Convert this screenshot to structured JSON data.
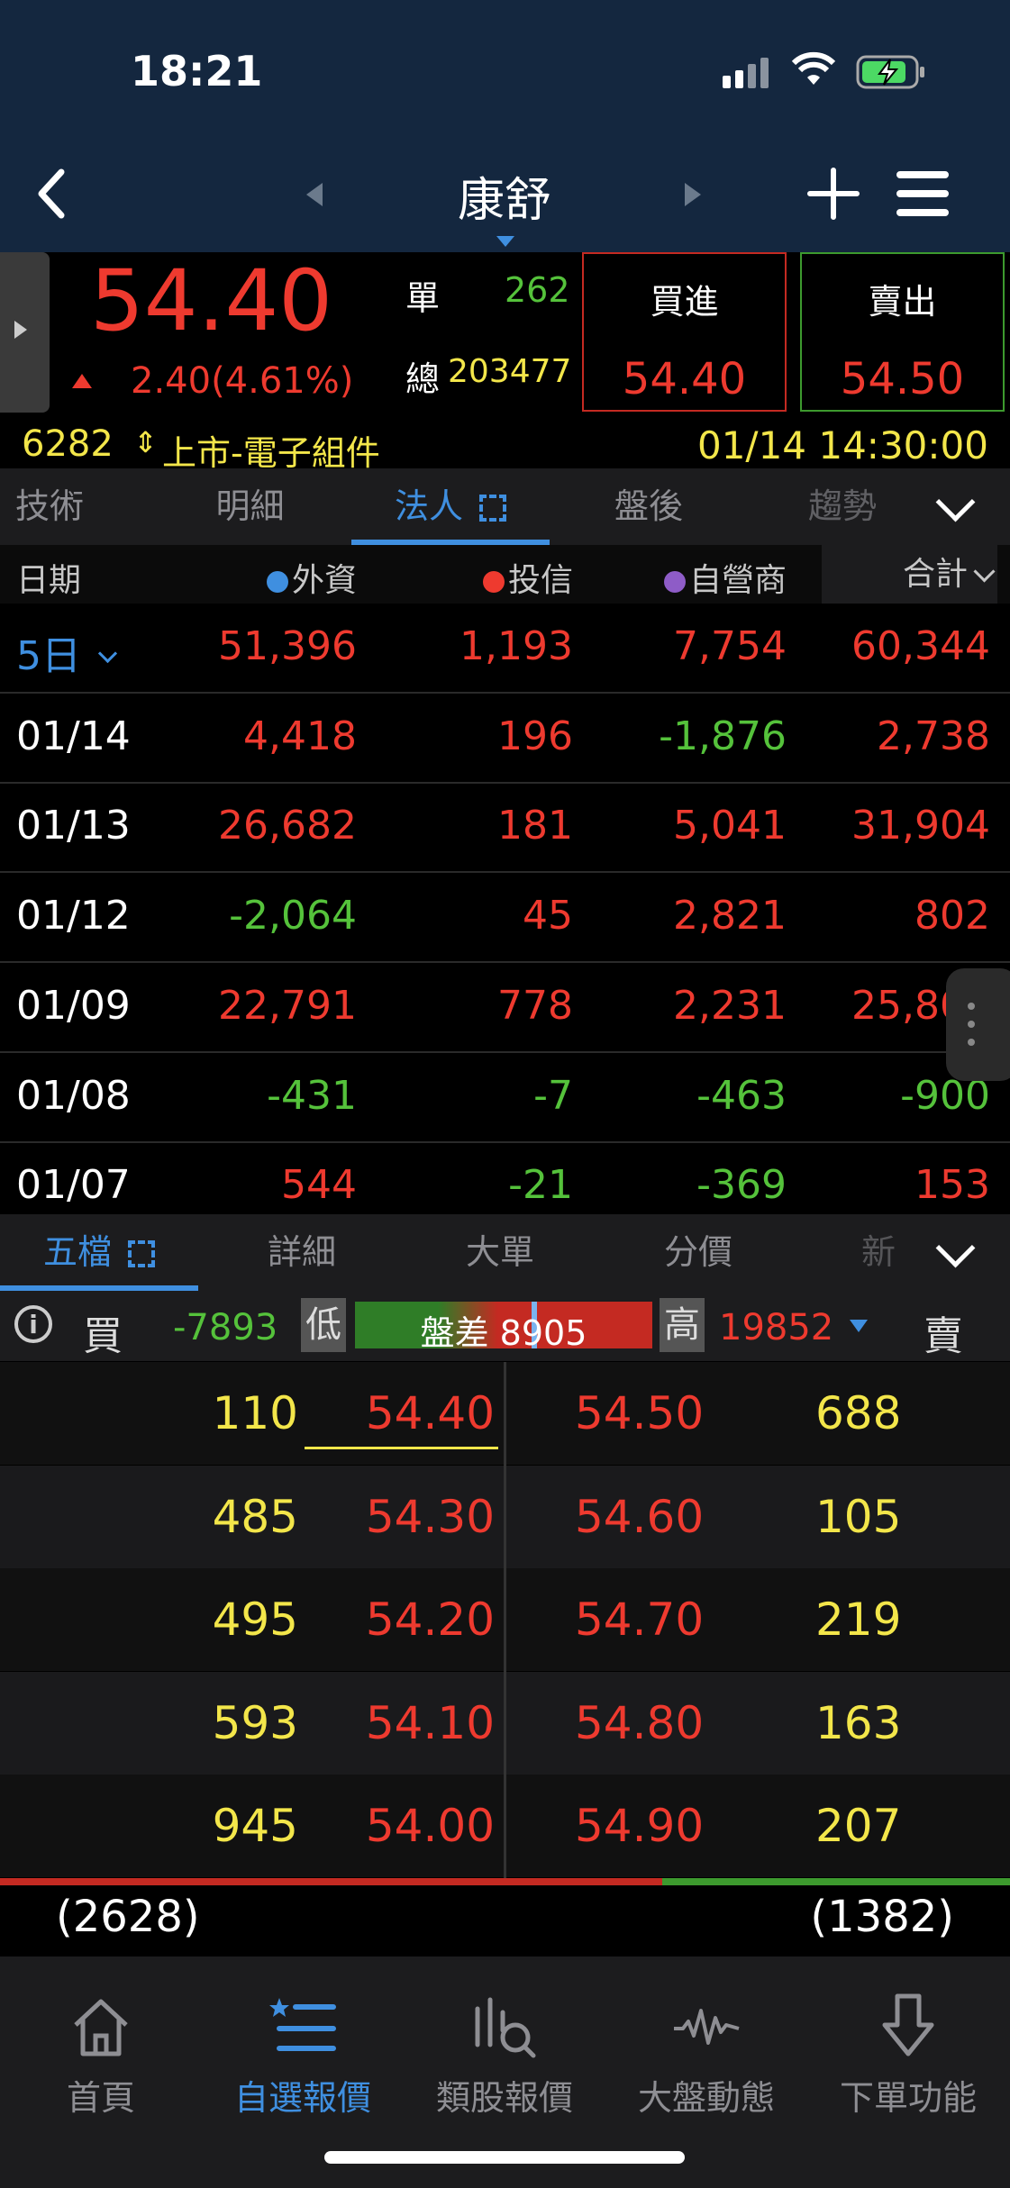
{
  "status_bar": {
    "time": "18:21"
  },
  "header": {
    "title": "康舒"
  },
  "quote": {
    "price": "54.40",
    "change": "2.40(4.61%)",
    "single_label": "單",
    "single_volume": "262",
    "total_label": "總",
    "total_volume": "203477",
    "bid_label": "買進",
    "bid_price": "54.40",
    "ask_label": "賣出",
    "ask_price": "54.50",
    "code": "6282",
    "market": "上市-電子組件",
    "datetime": "01/14 14:30:00"
  },
  "tabs1": [
    "技術",
    "明細",
    "法人",
    "盤後",
    "趨勢"
  ],
  "inst_table": {
    "headers": {
      "date": "日期",
      "foreign": "外資",
      "trust": "投信",
      "dealer": "自營商",
      "total": "合計"
    },
    "colors": {
      "foreign": "#3f8fe0",
      "trust": "#ee3a2f",
      "dealer": "#8e5cc7"
    },
    "period": "5日",
    "summary": [
      "51,396",
      "1,193",
      "7,754",
      "60,344"
    ],
    "rows": [
      {
        "date": "01/14",
        "v": [
          "4,418",
          "196",
          "-1,876",
          "2,738"
        ]
      },
      {
        "date": "01/13",
        "v": [
          "26,682",
          "181",
          "5,041",
          "31,904"
        ]
      },
      {
        "date": "01/12",
        "v": [
          "-2,064",
          "45",
          "2,821",
          "802"
        ]
      },
      {
        "date": "01/09",
        "v": [
          "22,791",
          "778",
          "2,231",
          "25,800"
        ]
      },
      {
        "date": "01/08",
        "v": [
          "-431",
          "-7",
          "-463",
          "-900"
        ]
      },
      {
        "date": "01/07",
        "v": [
          "544",
          "-21",
          "-369",
          "153"
        ]
      }
    ]
  },
  "tabs2": [
    "五檔",
    "詳細",
    "大單",
    "分價",
    "新"
  ],
  "spread": {
    "buy_label": "買",
    "low_value": "-7893",
    "low_label": "低",
    "diff_text": "盤差 8905",
    "high_label": "高",
    "high_value": "19852",
    "sell_label": "賣"
  },
  "order_book": [
    {
      "bid_qty": "110",
      "bid": "54.40",
      "ask": "54.50",
      "ask_qty": "688"
    },
    {
      "bid_qty": "485",
      "bid": "54.30",
      "ask": "54.60",
      "ask_qty": "105"
    },
    {
      "bid_qty": "495",
      "bid": "54.20",
      "ask": "54.70",
      "ask_qty": "219"
    },
    {
      "bid_qty": "593",
      "bid": "54.10",
      "ask": "54.80",
      "ask_qty": "163"
    },
    {
      "bid_qty": "945",
      "bid": "54.00",
      "ask": "54.90",
      "ask_qty": "207"
    }
  ],
  "totals": {
    "bid_total": "(2628)",
    "ask_total": "(1382)"
  },
  "nav": [
    "首頁",
    "自選報價",
    "類股報價",
    "大盤動態",
    "下單功能"
  ]
}
